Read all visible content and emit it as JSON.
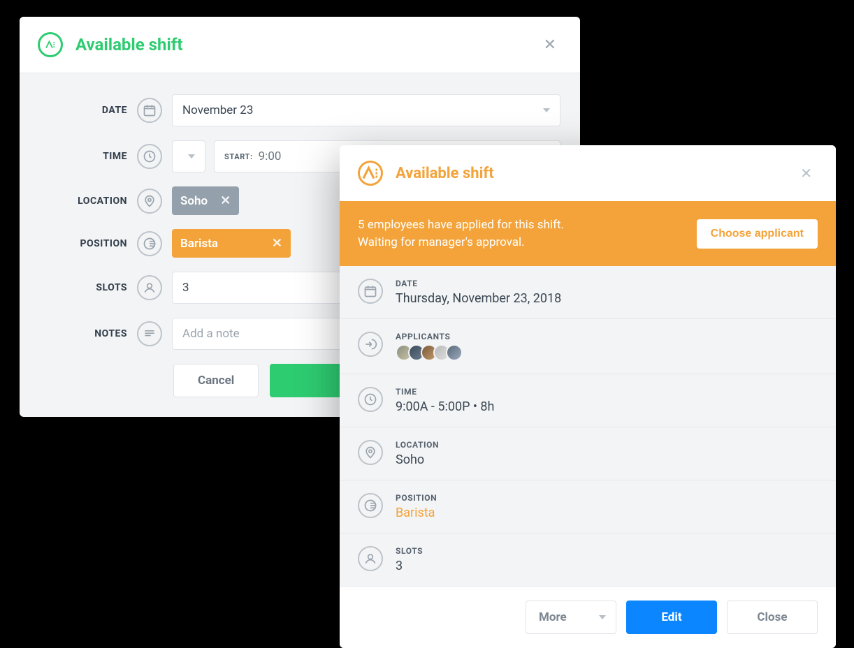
{
  "edit_modal": {
    "title": "Available shift",
    "fields": {
      "date_label": "DATE",
      "date_value": "November 23",
      "time_label": "TIME",
      "time_start_label": "START:",
      "time_start_value": "9:00",
      "location_label": "LOCATION",
      "location_chip": "Soho",
      "position_label": "POSITION",
      "position_chip": "Barista",
      "slots_label": "SLOTS",
      "slots_value": "3",
      "notes_label": "NOTES",
      "notes_placeholder": "Add a note"
    },
    "buttons": {
      "cancel": "Cancel",
      "save": " "
    }
  },
  "detail_modal": {
    "title": "Available shift",
    "banner": {
      "line1": "5 employees have applied for this shift.",
      "line2": "Waiting for manager's approval.",
      "cta": "Choose applicant"
    },
    "rows": {
      "date_label": "DATE",
      "date_value": "Thursday, November 23, 2018",
      "applicants_label": "APPLICANTS",
      "applicants_count": 5,
      "time_label": "TIME",
      "time_value": "9:00A - 5:00P • 8h",
      "location_label": "LOCATION",
      "location_value": "Soho",
      "position_label": "POSITION",
      "position_value": "Barista",
      "slots_label": "SLOTS",
      "slots_value": "3"
    },
    "buttons": {
      "more": "More",
      "edit": "Edit",
      "close": "Close"
    }
  }
}
